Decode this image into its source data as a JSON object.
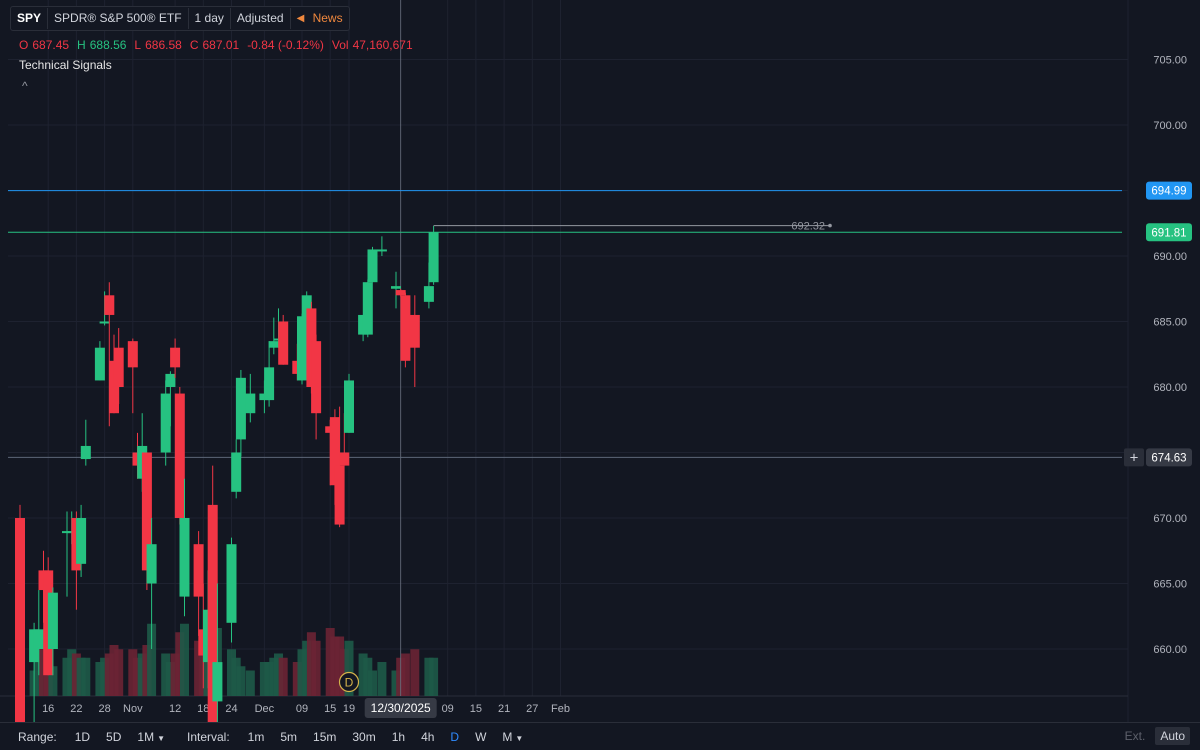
{
  "header": {
    "symbol": "SPY",
    "name": "SPDR® S&P 500® ETF",
    "interval": "1 day",
    "adjusted": "Adjusted",
    "news": "News"
  },
  "ohlc": {
    "o_label": "O",
    "o": "687.45",
    "h_label": "H",
    "h": "688.56",
    "l_label": "L",
    "l": "686.58",
    "c_label": "C",
    "c": "687.01",
    "change": "-0.84 (-0.12%)",
    "vol_label": "Vol",
    "vol": "47,160,671"
  },
  "technical_signals": "Technical Signals",
  "collapse_glyph": "^",
  "bottom": {
    "range_label": "Range:",
    "ranges": [
      "1D",
      "5D",
      "1M"
    ],
    "interval_label": "Interval:",
    "intervals": [
      "1m",
      "5m",
      "15m",
      "30m",
      "1h",
      "4h",
      "D",
      "W",
      "M"
    ],
    "active_interval": "D",
    "ext": "Ext.",
    "auto": "Auto"
  },
  "chart_data": {
    "type": "candlestick",
    "symbol": "SPY",
    "ylim": [
      657,
      707
    ],
    "y_ticks": [
      660,
      665,
      670,
      675,
      680,
      685,
      690,
      695,
      700,
      705
    ],
    "x_tick_labels": [
      {
        "label": "16",
        "date": "2025-10-16"
      },
      {
        "label": "22",
        "date": "2025-10-22"
      },
      {
        "label": "28",
        "date": "2025-10-28"
      },
      {
        "label": "Nov",
        "date": "2025-11-03"
      },
      {
        "label": "12",
        "date": "2025-11-12"
      },
      {
        "label": "18",
        "date": "2025-11-18"
      },
      {
        "label": "24",
        "date": "2025-11-24"
      },
      {
        "label": "Dec",
        "date": "2025-12-01"
      },
      {
        "label": "09",
        "date": "2025-12-09"
      },
      {
        "label": "15",
        "date": "2025-12-15"
      },
      {
        "label": "19",
        "date": "2025-12-19"
      },
      {
        "label": "09",
        "date": "2026-01-09"
      },
      {
        "label": "15",
        "date": "2026-01-15"
      },
      {
        "label": "21",
        "date": "2026-01-21"
      },
      {
        "label": "27",
        "date": "2026-01-27"
      },
      {
        "label": "Feb",
        "date": "2026-02-02"
      }
    ],
    "candles": [
      {
        "date": "2025-10-10",
        "open": 670,
        "high": 671,
        "low": 653,
        "close": 653
      },
      {
        "date": "2025-10-13",
        "open": 659,
        "high": 662,
        "low": 654,
        "close": 661.5
      },
      {
        "date": "2025-10-14",
        "open": 660,
        "high": 664.5,
        "low": 658,
        "close": 661.5
      },
      {
        "date": "2025-10-15",
        "open": 666,
        "high": 667.5,
        "low": 662,
        "close": 664.5
      },
      {
        "date": "2025-10-16",
        "open": 666,
        "high": 667,
        "low": 658,
        "close": 658
      },
      {
        "date": "2025-10-17",
        "open": 660,
        "high": 664.7,
        "low": 658,
        "close": 664.3
      },
      {
        "date": "2025-10-20",
        "open": 669,
        "high": 670.5,
        "low": 664,
        "close": 669
      },
      {
        "date": "2025-10-21",
        "open": 669,
        "high": 670.5,
        "low": 668,
        "close": 669
      },
      {
        "date": "2025-10-22",
        "open": 670,
        "high": 670.5,
        "low": 663,
        "close": 666
      },
      {
        "date": "2025-10-23",
        "open": 666.5,
        "high": 671,
        "low": 665.5,
        "close": 670
      },
      {
        "date": "2025-10-24",
        "open": 674.5,
        "high": 677.5,
        "low": 674,
        "close": 675.5
      },
      {
        "date": "2025-10-27",
        "open": 680.5,
        "high": 683.5,
        "low": 680.5,
        "close": 683
      },
      {
        "date": "2025-10-28",
        "open": 685,
        "high": 687.3,
        "low": 684.7,
        "close": 685
      },
      {
        "date": "2025-10-29",
        "open": 687,
        "high": 688,
        "low": 677,
        "close": 685.5
      },
      {
        "date": "2025-10-30",
        "open": 682,
        "high": 684,
        "low": 678,
        "close": 678
      },
      {
        "date": "2025-10-31",
        "open": 683,
        "high": 684.5,
        "low": 678.7,
        "close": 680
      },
      {
        "date": "2025-11-03",
        "open": 683.5,
        "high": 683.7,
        "low": 678,
        "close": 681.5
      },
      {
        "date": "2025-11-04",
        "open": 675,
        "high": 676.5,
        "low": 673,
        "close": 674
      },
      {
        "date": "2025-11-05",
        "open": 673,
        "high": 678,
        "low": 672,
        "close": 675.5
      },
      {
        "date": "2025-11-06",
        "open": 675,
        "high": 675,
        "low": 664.5,
        "close": 666
      },
      {
        "date": "2025-11-07",
        "open": 665,
        "high": 670,
        "low": 660,
        "close": 668
      },
      {
        "date": "2025-11-10",
        "open": 675,
        "high": 680.5,
        "low": 674,
        "close": 679.5
      },
      {
        "date": "2025-11-11",
        "open": 680,
        "high": 681.2,
        "low": 677,
        "close": 681
      },
      {
        "date": "2025-11-12",
        "open": 683,
        "high": 683.7,
        "low": 680.7,
        "close": 681.5
      },
      {
        "date": "2025-11-13",
        "open": 679.5,
        "high": 680,
        "low": 669.5,
        "close": 670
      },
      {
        "date": "2025-11-14",
        "open": 664,
        "high": 673,
        "low": 662.5,
        "close": 670
      },
      {
        "date": "2025-11-17",
        "open": 668,
        "high": 669,
        "low": 661,
        "close": 664
      },
      {
        "date": "2025-11-18",
        "open": 661.5,
        "high": 665,
        "low": 657,
        "close": 659.5
      },
      {
        "date": "2025-11-19",
        "open": 659,
        "high": 666,
        "low": 657,
        "close": 663
      },
      {
        "date": "2025-11-20",
        "open": 671,
        "high": 674,
        "low": 651.5,
        "close": 652.5
      },
      {
        "date": "2025-11-21",
        "open": 656,
        "high": 665,
        "low": 654,
        "close": 659
      },
      {
        "date": "2025-11-24",
        "open": 662,
        "high": 668.5,
        "low": 660.5,
        "close": 668
      },
      {
        "date": "2025-11-25",
        "open": 672,
        "high": 676,
        "low": 671.5,
        "close": 675
      },
      {
        "date": "2025-11-26",
        "open": 676,
        "high": 681.3,
        "low": 674.7,
        "close": 680.7
      },
      {
        "date": "2025-11-28",
        "open": 678,
        "high": 681,
        "low": 677.3,
        "close": 679.5
      },
      {
        "date": "2025-12-01",
        "open": 679,
        "high": 680.5,
        "low": 678,
        "close": 679.5
      },
      {
        "date": "2025-12-02",
        "open": 679,
        "high": 683.5,
        "low": 678.5,
        "close": 681.5
      },
      {
        "date": "2025-12-03",
        "open": 683,
        "high": 685.3,
        "low": 682.5,
        "close": 683.5
      },
      {
        "date": "2025-12-04",
        "open": 683.7,
        "high": 686,
        "low": 683,
        "close": 683.7
      },
      {
        "date": "2025-12-05",
        "open": 685,
        "high": 685.5,
        "low": 681.7,
        "close": 681.7
      },
      {
        "date": "2025-12-08",
        "open": 682,
        "high": 683.3,
        "low": 680.5,
        "close": 681
      },
      {
        "date": "2025-12-09",
        "open": 680.5,
        "high": 685.6,
        "low": 680.2,
        "close": 685.4
      },
      {
        "date": "2025-12-10",
        "open": 684,
        "high": 687.3,
        "low": 683.5,
        "close": 687
      },
      {
        "date": "2025-12-11",
        "open": 686,
        "high": 686.5,
        "low": 679.5,
        "close": 680
      },
      {
        "date": "2025-12-12",
        "open": 683.5,
        "high": 684,
        "low": 676,
        "close": 678
      },
      {
        "date": "2025-12-15",
        "open": 677,
        "high": 677.5,
        "low": 672.5,
        "close": 676.5
      },
      {
        "date": "2025-12-16",
        "open": 677.7,
        "high": 678.3,
        "low": 671,
        "close": 672.5
      },
      {
        "date": "2025-12-17",
        "open": 674,
        "high": 678.5,
        "low": 669.3,
        "close": 669.5
      },
      {
        "date": "2025-12-18",
        "open": 675,
        "high": 678,
        "low": 674,
        "close": 674
      },
      {
        "date": "2025-12-19",
        "open": 676.5,
        "high": 681,
        "low": 676.5,
        "close": 680.5
      },
      {
        "date": "2025-12-22",
        "open": 684,
        "high": 685.5,
        "low": 683.5,
        "close": 685.5
      },
      {
        "date": "2025-12-23",
        "open": 684,
        "high": 688.2,
        "low": 683.8,
        "close": 688
      },
      {
        "date": "2025-12-24",
        "open": 688,
        "high": 690.7,
        "low": 688,
        "close": 690.5
      },
      {
        "date": "2025-12-26",
        "open": 690.5,
        "high": 691.5,
        "low": 690,
        "close": 690.5
      },
      {
        "date": "2025-12-29",
        "open": 687.5,
        "high": 688.8,
        "low": 686,
        "close": 687.7
      },
      {
        "date": "2025-12-30",
        "open": 687.4,
        "high": 687.5,
        "low": 686.9,
        "close": 687
      },
      {
        "date": "2025-12-31",
        "open": 687,
        "high": 687.2,
        "low": 681.5,
        "close": 682
      },
      {
        "date": "2026-01-02",
        "open": 685.5,
        "high": 687,
        "low": 680,
        "close": 683
      },
      {
        "date": "2026-01-05",
        "open": 686.5,
        "high": 689.5,
        "low": 686,
        "close": 687.7
      },
      {
        "date": "2026-01-06",
        "open": 688,
        "high": 692.3,
        "low": 687.8,
        "close": 691.8
      }
    ],
    "volume_relative": [
      0.6,
      0.3,
      0.55,
      0.7,
      0.5,
      0.35,
      0.45,
      0.55,
      0.5,
      0.45,
      0.45,
      0.4,
      0.45,
      0.5,
      0.6,
      0.55,
      0.55,
      0.45,
      0.5,
      0.6,
      0.85,
      0.5,
      0.4,
      0.5,
      0.75,
      0.85,
      0.65,
      0.5,
      0.7,
      0.95,
      0.8,
      0.55,
      0.45,
      0.35,
      0.3,
      0.4,
      0.4,
      0.45,
      0.5,
      0.45,
      0.4,
      0.55,
      0.65,
      0.75,
      0.65,
      0.8,
      0.7,
      0.7,
      0.55,
      0.65,
      0.5,
      0.45,
      0.3,
      0.4,
      0.3,
      0.45,
      0.5,
      0.55,
      0.45,
      0.45
    ],
    "price_lines": [
      {
        "value": 694.99,
        "label": "694.99",
        "color": "#2196f3"
      },
      {
        "value": 691.81,
        "label": "691.81",
        "color": "#26c281"
      },
      {
        "value": 674.63,
        "label": "674.63",
        "color": "#5d6778"
      }
    ],
    "high_marker": {
      "value": 692.32,
      "label": "692.32"
    },
    "crosshair": {
      "date": "2025-12-30",
      "label": "12/30/2025"
    },
    "colors": {
      "up": "#26c281",
      "down": "#f23645",
      "background": "#131722",
      "grid": "#1e2230",
      "text": "#b2b5be"
    }
  }
}
